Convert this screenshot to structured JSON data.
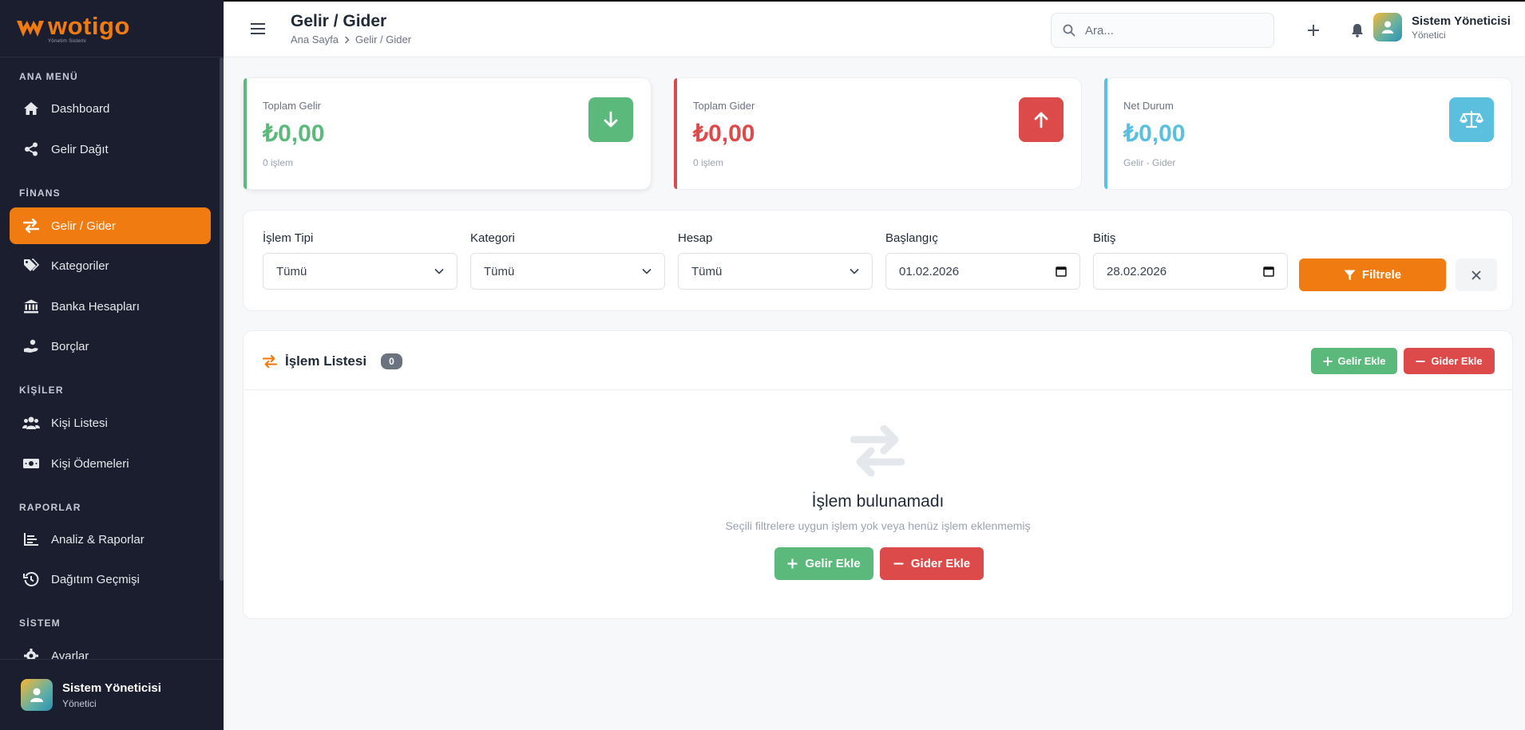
{
  "brand": {
    "name": "wotigo",
    "tagline": "Yönetim Sistemi"
  },
  "sidebar": {
    "sections": {
      "main": "ANA MENÜ",
      "finance": "FİNANS",
      "people": "KİŞİLER",
      "reports": "RAPORLAR",
      "system": "SİSTEM"
    },
    "items": [
      {
        "label": "Dashboard",
        "icon": "home-icon"
      },
      {
        "label": "Gelir Dağıt",
        "icon": "share-icon"
      },
      {
        "label": "Gelir / Gider",
        "icon": "exchange-icon",
        "active": true
      },
      {
        "label": "Kategoriler",
        "icon": "tags-icon"
      },
      {
        "label": "Banka Hesapları",
        "icon": "bank-icon"
      },
      {
        "label": "Borçlar",
        "icon": "hand-coins-icon"
      },
      {
        "label": "Kişi Listesi",
        "icon": "users-icon"
      },
      {
        "label": "Kişi Ödemeleri",
        "icon": "money-icon"
      },
      {
        "label": "Analiz & Raporlar",
        "icon": "chart-icon"
      },
      {
        "label": "Dağıtım Geçmişi",
        "icon": "history-icon"
      },
      {
        "label": "Ayarlar",
        "icon": "gear-icon"
      }
    ],
    "user": {
      "name": "Sistem Yöneticisi",
      "role": "Yönetici"
    }
  },
  "header": {
    "title": "Gelir / Gider",
    "breadcrumb": [
      "Ana Sayfa",
      "Gelir / Gider"
    ],
    "search_placeholder": "Ara...",
    "user": {
      "name": "Sistem Yöneticisi",
      "role": "Yönetici"
    }
  },
  "stats": [
    {
      "label": "Toplam Gelir",
      "value": "₺0,00",
      "sub": "0 işlem",
      "color": "#5cb97c",
      "icon": "arrow-down-icon"
    },
    {
      "label": "Toplam Gider",
      "value": "₺0,00",
      "sub": "0 işlem",
      "color": "#dc4a4a",
      "icon": "arrow-up-icon"
    },
    {
      "label": "Net Durum",
      "value": "₺0,00",
      "sub": "Gelir - Gider",
      "color": "#5bc0de",
      "icon": "scale-icon"
    }
  ],
  "filters": {
    "type": {
      "label": "İşlem Tipi",
      "value": "Tümü"
    },
    "category": {
      "label": "Kategori",
      "value": "Tümü"
    },
    "account": {
      "label": "Hesap",
      "value": "Tümü"
    },
    "start": {
      "label": "Başlangıç",
      "value": "01.02.2026"
    },
    "end": {
      "label": "Bitiş",
      "value": "28.02.2026"
    },
    "apply_label": "Filtrele"
  },
  "list": {
    "title": "İşlem Listesi",
    "count": "0",
    "add_income_label": "Gelir Ekle",
    "add_expense_label": "Gider Ekle",
    "empty_title": "İşlem bulunamadı",
    "empty_subtitle": "Seçili filtrelere uygun işlem yok veya henüz işlem eklenmemiş"
  },
  "colors": {
    "accent": "#f07b10",
    "sidebar_bg": "#1b1e2e",
    "income": "#5cb97c",
    "expense": "#dc4a4a",
    "net": "#5bc0de"
  }
}
